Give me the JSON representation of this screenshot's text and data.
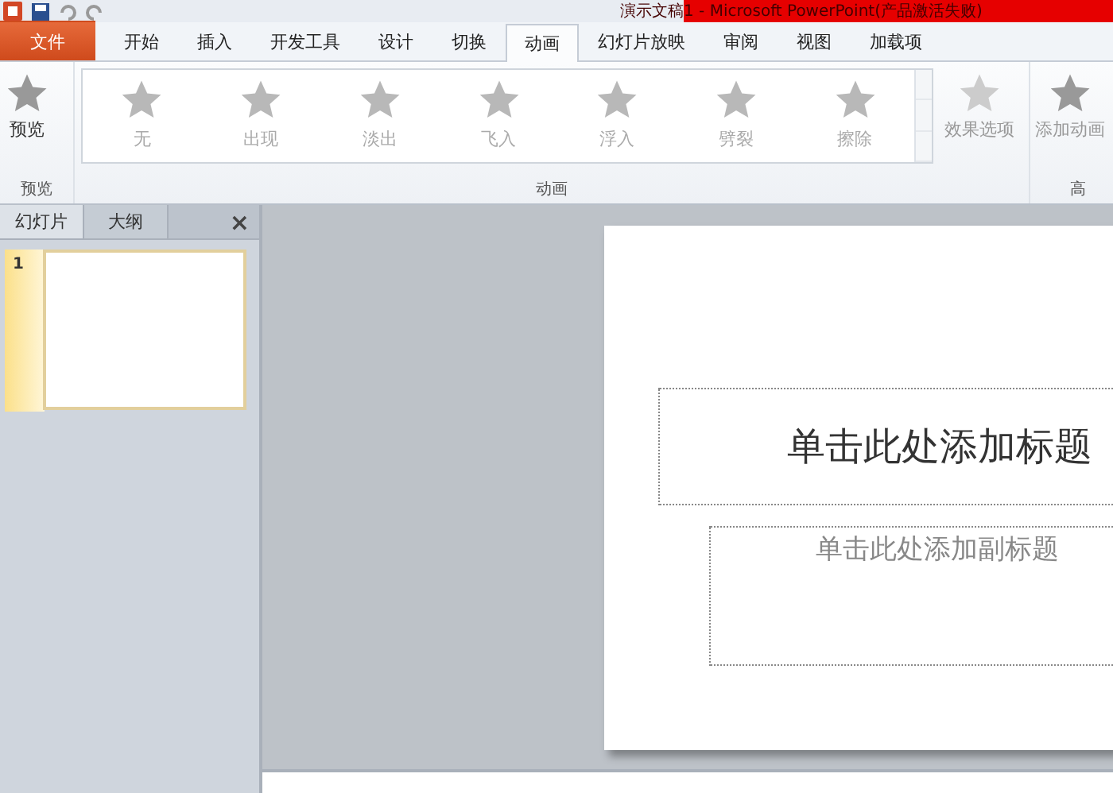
{
  "window": {
    "title": "演示文稿1 - Microsoft PowerPoint(产品激活失败)"
  },
  "ribbon_tabs": [
    {
      "label": "文件",
      "kind": "file",
      "selected": false
    },
    {
      "label": "开始",
      "kind": "tab",
      "selected": false
    },
    {
      "label": "插入",
      "kind": "tab",
      "selected": false
    },
    {
      "label": "开发工具",
      "kind": "tab",
      "selected": false
    },
    {
      "label": "设计",
      "kind": "tab",
      "selected": false
    },
    {
      "label": "切换",
      "kind": "tab",
      "selected": false
    },
    {
      "label": "动画",
      "kind": "tab",
      "selected": true
    },
    {
      "label": "幻灯片放映",
      "kind": "tab",
      "selected": false
    },
    {
      "label": "审阅",
      "kind": "tab",
      "selected": false
    },
    {
      "label": "视图",
      "kind": "tab",
      "selected": false
    },
    {
      "label": "加载项",
      "kind": "tab",
      "selected": false
    }
  ],
  "preview_group": {
    "button": "预览",
    "label": "预览"
  },
  "animation_group": {
    "label": "动画",
    "effects": [
      "无",
      "出现",
      "淡出",
      "飞入",
      "浮入",
      "劈裂",
      "擦除"
    ],
    "effect_options": "效果选项"
  },
  "advanced_group": {
    "button": "添加动画",
    "label": "高"
  },
  "slides_panel": {
    "tabs": [
      {
        "label": "幻灯片",
        "selected": true
      },
      {
        "label": "大纲",
        "selected": false
      }
    ],
    "close": "×",
    "slides": [
      {
        "number": "1",
        "selected": true
      }
    ]
  },
  "slide": {
    "title_placeholder": "单击此处添加标题",
    "subtitle_placeholder": "单击此处添加副标题"
  }
}
